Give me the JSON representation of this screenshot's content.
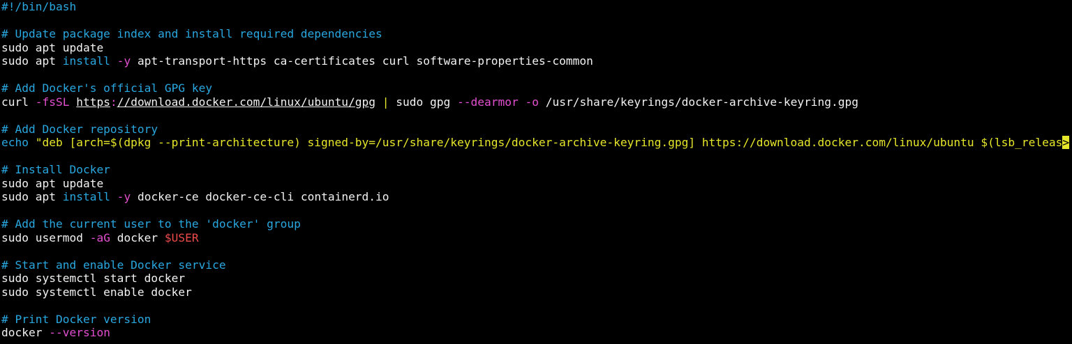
{
  "colors": {
    "background": "#000000",
    "default_text": "#f2f2f2",
    "comment": "#29a8e0",
    "flag": "#e34fd0",
    "variable": "#ee4a4a",
    "string": "#e6e62a"
  },
  "lines": [
    {
      "segments": [
        {
          "text": "#!/bin/bash",
          "style": "comment"
        }
      ]
    },
    {
      "segments": []
    },
    {
      "segments": [
        {
          "text": "# Update package index and install required dependencies",
          "style": "comment"
        }
      ]
    },
    {
      "segments": [
        {
          "text": "sudo apt update",
          "style": "white"
        }
      ]
    },
    {
      "segments": [
        {
          "text": "sudo apt ",
          "style": "white"
        },
        {
          "text": "install",
          "style": "keyword"
        },
        {
          "text": " ",
          "style": "white"
        },
        {
          "text": "-y",
          "style": "flag"
        },
        {
          "text": " apt-transport-https ca-certificates curl software-properties-common",
          "style": "white"
        }
      ]
    },
    {
      "segments": []
    },
    {
      "segments": [
        {
          "text": "# Add Docker's official GPG key",
          "style": "comment"
        }
      ]
    },
    {
      "segments": [
        {
          "text": "curl ",
          "style": "white"
        },
        {
          "text": "-fsSL",
          "style": "flag"
        },
        {
          "text": " ",
          "style": "white"
        },
        {
          "text": "https",
          "style": "white-u"
        },
        {
          "text": ":",
          "style": "flag"
        },
        {
          "text": "//download.docker.com/linux/ubuntu/gpg",
          "style": "white-u"
        },
        {
          "text": " ",
          "style": "white"
        },
        {
          "text": "|",
          "style": "pipe"
        },
        {
          "text": " sudo gpg ",
          "style": "white"
        },
        {
          "text": "--dearmor",
          "style": "flag"
        },
        {
          "text": " ",
          "style": "white"
        },
        {
          "text": "-o",
          "style": "flag"
        },
        {
          "text": " /usr/share/keyrings/docker-archive-keyring.gpg",
          "style": "white"
        }
      ]
    },
    {
      "segments": []
    },
    {
      "segments": [
        {
          "text": "# Add Docker repository",
          "style": "comment"
        }
      ]
    },
    {
      "segments": [
        {
          "text": "echo",
          "style": "keyword"
        },
        {
          "text": " \"deb [arch=$(dpkg --print-architecture) signed-by=/usr/share/keyrings/docker-archive-keyring.gpg] https://download.docker.com/linux/ubuntu $(lsb_releas",
          "style": "string"
        },
        {
          "text": ">",
          "style": "cursor"
        }
      ]
    },
    {
      "segments": []
    },
    {
      "segments": [
        {
          "text": "# Install Docker",
          "style": "comment"
        }
      ]
    },
    {
      "segments": [
        {
          "text": "sudo apt update",
          "style": "white"
        }
      ]
    },
    {
      "segments": [
        {
          "text": "sudo apt ",
          "style": "white"
        },
        {
          "text": "install",
          "style": "keyword"
        },
        {
          "text": " ",
          "style": "white"
        },
        {
          "text": "-y",
          "style": "flag"
        },
        {
          "text": " docker-ce docker-ce-cli containerd.io",
          "style": "white"
        }
      ]
    },
    {
      "segments": []
    },
    {
      "segments": [
        {
          "text": "# Add the current user to the 'docker' group",
          "style": "comment"
        }
      ]
    },
    {
      "segments": [
        {
          "text": "sudo usermod ",
          "style": "white"
        },
        {
          "text": "-aG",
          "style": "flag"
        },
        {
          "text": " docker ",
          "style": "white"
        },
        {
          "text": "$USER",
          "style": "var"
        }
      ]
    },
    {
      "segments": []
    },
    {
      "segments": [
        {
          "text": "# Start and enable Docker service",
          "style": "comment"
        }
      ]
    },
    {
      "segments": [
        {
          "text": "sudo systemctl start docker",
          "style": "white"
        }
      ]
    },
    {
      "segments": [
        {
          "text": "sudo systemctl enable docker",
          "style": "white"
        }
      ]
    },
    {
      "segments": []
    },
    {
      "segments": [
        {
          "text": "# Print Docker version",
          "style": "comment"
        }
      ]
    },
    {
      "segments": [
        {
          "text": "docker ",
          "style": "white"
        },
        {
          "text": "--version",
          "style": "flag"
        }
      ]
    }
  ]
}
